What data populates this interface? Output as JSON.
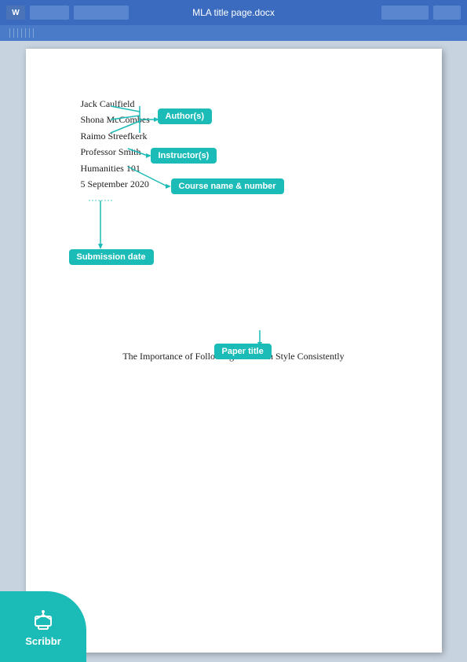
{
  "toolbar": {
    "title": "MLA title page.docx",
    "buttons": [
      "btn1",
      "btn2",
      "btn3",
      "btn4",
      "btn5"
    ]
  },
  "document": {
    "authors": [
      "Jack Caulfield",
      "Shona McCombes",
      "Raimo Streefkerk"
    ],
    "instructor": "Professor Smith",
    "course": "Humanities 101",
    "date": "5 September 2020",
    "paper_title": "The Importance of Following a Citation Style Consistently"
  },
  "annotations": {
    "authors_label": "Author(s)",
    "instructor_label": "Instructor(s)",
    "course_label": "Course name & number",
    "date_label": "Submission date",
    "title_label": "Paper title"
  },
  "branding": {
    "name": "Scribbr",
    "color": "#1bbcb8"
  }
}
